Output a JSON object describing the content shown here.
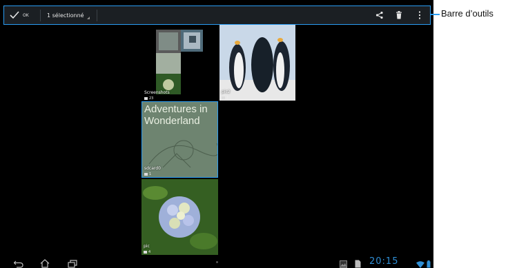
{
  "actionbar": {
    "ok_label": "OK",
    "selection_label": "1 sélectionné"
  },
  "callout": {
    "label": "Barre d’outils",
    "color": "#2a9df4"
  },
  "albums": [
    {
      "name": "Screenshots",
      "count": "23"
    },
    {
      "name": "pic2",
      "count": "1"
    },
    {
      "name": "sdcard0",
      "count": "1"
    },
    {
      "name": "pic",
      "count": "4"
    }
  ],
  "sdcard_cover_text": "Adventures in Wonderland",
  "status_bar": {
    "time": "20:15"
  },
  "icons": {
    "ok": "check-icon",
    "share": "share-icon",
    "delete": "trash-icon",
    "menu": "overflow-menu-icon",
    "back": "back-icon",
    "home": "home-icon",
    "recent": "recent-apps-icon",
    "gallery": "gallery-icon",
    "file": "file-icon",
    "wifi": "wifi-icon",
    "battery": "battery-icon"
  }
}
